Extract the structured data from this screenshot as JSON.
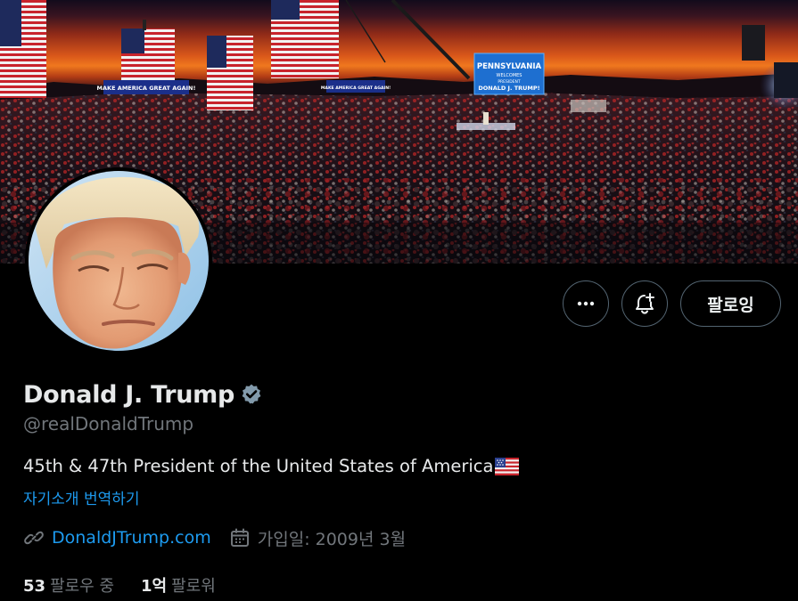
{
  "profile": {
    "display_name": "Donald J. Trump",
    "handle": "@realDonaldTrump",
    "bio": "45th & 47th President of the United States of America",
    "bio_translate_label": "자기소개 번역하기",
    "website": "DonaldJTrump.com",
    "joined": "가입일: 2009년 3월"
  },
  "banner": {
    "billboard_text": {
      "line1": "PENNSYLVANIA",
      "line2": "WELCOMES",
      "line3": "PRESIDENT",
      "line4": "DONALD J. TRUMP!"
    },
    "sign_left": "MAKE AMERICA GREAT AGAIN!",
    "sign_right": "MAKE AMERICA GREAT AGAIN!"
  },
  "actions": {
    "more_icon": "more-horizontal-icon",
    "notify_icon": "bell-plus-icon",
    "follow_label": "팔로잉"
  },
  "stats": {
    "following_count": "53",
    "following_label": "팔로우 중",
    "followers_count": "1억",
    "followers_label": "팔로워"
  },
  "colors": {
    "background": "#000000",
    "text_primary": "#e7e9ea",
    "text_secondary": "#71767b",
    "accent": "#1d9bf0",
    "border": "#536471",
    "verified": "#829aab"
  }
}
